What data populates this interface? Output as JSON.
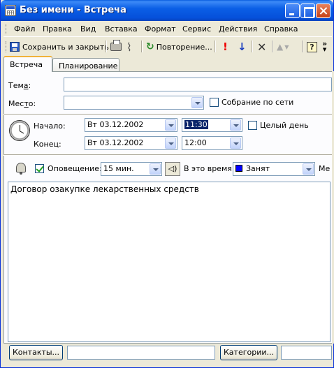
{
  "window": {
    "title": "Без имени - Встреча"
  },
  "menu": [
    "Файл",
    "Правка",
    "Вид",
    "Вставка",
    "Формат",
    "Сервис",
    "Действия",
    "Справка"
  ],
  "toolbar": {
    "save_close": "Сохранить и закрыть",
    "recurrence": "Повторение...",
    "importance_high": "!",
    "importance_low": "↓",
    "delete": "✕",
    "help": "?",
    "more": "»"
  },
  "tabs": [
    "Встреча",
    "Планирование"
  ],
  "form": {
    "subject_label": "Тема:",
    "subject_value": "",
    "location_label": "Место:",
    "location_value": "",
    "online_meeting_label": "Собрание по сети",
    "online_meeting_checked": false,
    "start_label": "Начало:",
    "start_date": "Вт 03.12.2002",
    "start_time": "11:30",
    "all_day_label": "Целый день",
    "all_day_checked": false,
    "end_label": "Конец:",
    "end_date": "Вт 03.12.2002",
    "end_time": "12:00",
    "reminder_label": "Оповещение:",
    "reminder_checked": true,
    "reminder_value": "15 мин.",
    "show_as_label": "В это время:",
    "show_as_value": "Занят",
    "show_as_color": "#0000ff",
    "label_truncated": "Ме"
  },
  "notes": {
    "text": "Договор озакупке лекарственных средств"
  },
  "bottom": {
    "contacts_button": "Контакты...",
    "contacts_value": "",
    "categories_button": "Категории...",
    "categories_value": ""
  },
  "colors": {
    "titlebar": "#0550da",
    "face": "#ece9d8",
    "field_border": "#7f9db9",
    "tab_highlight": "#f0b23a"
  }
}
